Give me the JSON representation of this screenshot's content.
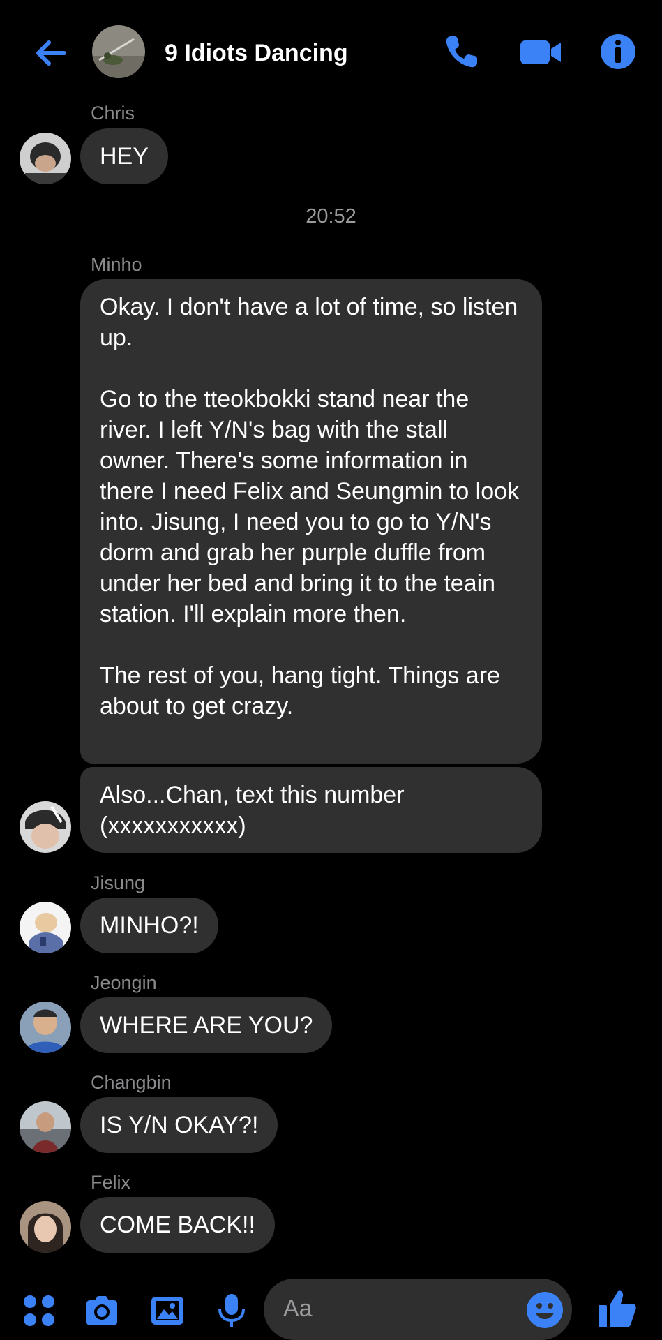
{
  "header": {
    "title": "9 Idiots Dancing",
    "icons": [
      "back-arrow-icon",
      "phone-icon",
      "video-camera-icon",
      "info-icon"
    ],
    "accent_color": "#3b82f6"
  },
  "messages": [
    {
      "sender": "Chris",
      "text": "HEY"
    },
    {
      "timestamp": "20:52"
    },
    {
      "sender": "Minho",
      "paragraphs": [
        "Okay. I don't have a lot of time, so listen up.",
        "Go to the tteokbokki stand near the river. I left Y/N's bag with the stall owner. There's some information in there I need Felix and Seungmin to look into. Jisung, I need you to go to Y/N's dorm and grab her purple duffle from under her bed and bring it to the teain station. I'll explain more then.",
        "The rest of you, hang tight. Things are about to get crazy."
      ]
    },
    {
      "sender": "Minho",
      "text": "Also...Chan, text this number (xxxxxxxxxxx)"
    },
    {
      "sender": "Jisung",
      "text": "MINHO?!"
    },
    {
      "sender": "Jeongin",
      "text": "WHERE ARE YOU?"
    },
    {
      "sender": "Changbin",
      "text": "IS Y/N OKAY?!"
    },
    {
      "sender": "Felix",
      "text": "COME BACK!!"
    }
  ],
  "composer": {
    "placeholder": "Aa",
    "icons": [
      "apps-grid-icon",
      "camera-icon",
      "image-icon",
      "microphone-icon",
      "emoji-icon",
      "thumbs-up-icon"
    ]
  },
  "colors": {
    "background": "#000000",
    "bubble": "#303030",
    "accent": "#3b82f6",
    "muted_text": "#8a8a8d"
  }
}
